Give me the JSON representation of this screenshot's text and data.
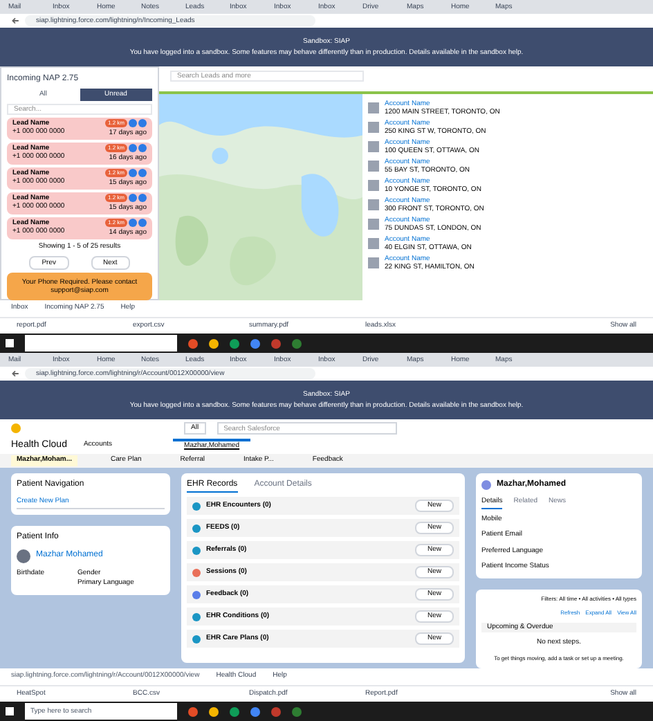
{
  "top": {
    "browser_tabs": [
      "Mail",
      "Inbox",
      "Home",
      "Notes",
      "Leads",
      "Inbox",
      "Inbox",
      "Inbox",
      "Drive",
      "Maps",
      "Home",
      "Maps"
    ],
    "url": "siap.lightning.force.com/lightning/n/Incoming_Leads",
    "banner": {
      "title": "Sandbox: SIAP",
      "message": "You have logged into a sandbox. Some features may behave differently than in production. Details available in the sandbox help."
    },
    "panel": {
      "title": "Incoming NAP 2.75",
      "tabs": [
        {
          "label": "All",
          "selected": false
        },
        {
          "label": "Unread",
          "selected": true
        }
      ],
      "search": {
        "placeholder": "Search..."
      },
      "cards": [
        {
          "name": "Lead Name",
          "phone": "+1 000 000 0000",
          "time": "17 days ago",
          "badge": "1.2 km"
        },
        {
          "name": "Lead Name",
          "phone": "+1 000 000 0000",
          "time": "16 days ago",
          "badge": "1.2 km"
        },
        {
          "name": "Lead Name",
          "phone": "+1 000 000 0000",
          "time": "15 days ago",
          "badge": "1.2 km"
        },
        {
          "name": "Lead Name",
          "phone": "+1 000 000 0000",
          "time": "15 days ago",
          "badge": "1.2 km"
        },
        {
          "name": "Lead Name",
          "phone": "+1 000 000 0000",
          "time": "14 days ago",
          "badge": "1.2 km"
        }
      ],
      "footer": "Showing 1 - 5 of 25 results",
      "buttons": [
        "Prev",
        "Next"
      ],
      "warning": "Your Phone Required. Please contact support@siap.com"
    },
    "search": {
      "placeholder": "Search Leads and more"
    },
    "accounts": [
      {
        "name": "Account Name",
        "address": "1200 MAIN STREET, TORONTO, ON"
      },
      {
        "name": "Account Name",
        "address": "250 KING ST W, TORONTO, ON"
      },
      {
        "name": "Account Name",
        "address": "100 QUEEN ST, OTTAWA, ON"
      },
      {
        "name": "Account Name",
        "address": "55 BAY ST, TORONTO, ON"
      },
      {
        "name": "Account Name",
        "address": "10 YONGE ST, TORONTO, ON"
      },
      {
        "name": "Account Name",
        "address": "300 FRONT ST, TORONTO, ON"
      },
      {
        "name": "Account Name",
        "address": "75 DUNDAS ST, LONDON, ON"
      },
      {
        "name": "Account Name",
        "address": "40 ELGIN ST, OTTAWA, ON"
      },
      {
        "name": "Account Name",
        "address": "22 KING ST, HAMILTON, ON"
      }
    ],
    "app_tabs": [
      "Inbox",
      "Incoming NAP 2.75",
      "Help"
    ],
    "downloads": [
      "report.pdf",
      "export.csv",
      "summary.pdf",
      "leads.xlsx"
    ],
    "show_all": "Show all"
  },
  "bottom": {
    "browser_tabs": [
      "Mail",
      "Inbox",
      "Home",
      "Notes",
      "Leads",
      "Inbox",
      "Inbox",
      "Inbox",
      "Drive",
      "Maps",
      "Home",
      "Maps"
    ],
    "url": "siap.lightning.force.com/lightning/r/Account/0012X00000/view",
    "banner": {
      "title": "Sandbox: SIAP",
      "message": "You have logged into a sandbox. Some features may behave differently than in production. Details available in the sandbox help."
    },
    "search": {
      "scope": "All",
      "placeholder": "Search Salesforce"
    },
    "app_name": "Health Cloud",
    "nav": [
      "Accounts"
    ],
    "record_tab": "Mazhar,Mohamed",
    "subtabs": [
      {
        "label": "Mazhar,Moham...",
        "selected": true
      },
      {
        "label": "Care Plan",
        "selected": false
      },
      {
        "label": "Referral",
        "selected": false
      },
      {
        "label": "Intake P...",
        "selected": false
      },
      {
        "label": "Feedback",
        "selected": false
      }
    ],
    "navigation": {
      "title": "Patient Navigation",
      "select": "Create New Plan"
    },
    "info": {
      "title": "Patient Info",
      "name": "Mazhar Mohamed",
      "fields": [
        {
          "label": "Birthdate"
        },
        {
          "label": "Gender",
          "value": "Primary Language"
        }
      ]
    },
    "record_tabs": [
      {
        "label": "EHR Records",
        "selected": true
      },
      {
        "label": "Account Details",
        "selected": false
      }
    ],
    "related": [
      {
        "title": "EHR Encounters (0)",
        "color": "#1b96c4",
        "new": "New"
      },
      {
        "title": "FEEDS (0)",
        "color": "#1b96c4",
        "new": "New"
      },
      {
        "title": "Referrals (0)",
        "color": "#1b96c4",
        "new": "New"
      },
      {
        "title": "Sessions (0)",
        "color": "#e9705a",
        "new": "New"
      },
      {
        "title": "Feedback (0)",
        "color": "#5a7ee9",
        "new": "New"
      },
      {
        "title": "EHR Conditions (0)",
        "color": "#1b96c4",
        "new": "New"
      },
      {
        "title": "EHR Care Plans (0)",
        "color": "#1b96c4",
        "new": "New"
      }
    ],
    "person": {
      "name": "Mazhar,Mohamed",
      "tabs": [
        {
          "label": "Details",
          "selected": true
        },
        {
          "label": "Related",
          "selected": false
        },
        {
          "label": "News",
          "selected": false
        }
      ],
      "fields": [
        "Mobile",
        "Patient Email",
        "Preferred Language",
        "Patient Income Status"
      ]
    },
    "activity": {
      "filters": "Filters: All time • All activities • All types",
      "links": [
        "Refresh",
        "Expand All",
        "View All"
      ],
      "section": "Upcoming & Overdue",
      "empty": "No next steps.",
      "hint": "To get things moving, add a task or set up a meeting."
    },
    "status_url": "siap.lightning.force.com/lightning/r/Account/0012X00000/view",
    "app_tabs": [
      "Health Cloud",
      "Help"
    ],
    "downloads": [
      "HeatSpot",
      "BCC.csv",
      "Dispatch.pdf",
      "Report.pdf"
    ],
    "show_all": "Show all",
    "taskbar_search": "Type here to search"
  }
}
